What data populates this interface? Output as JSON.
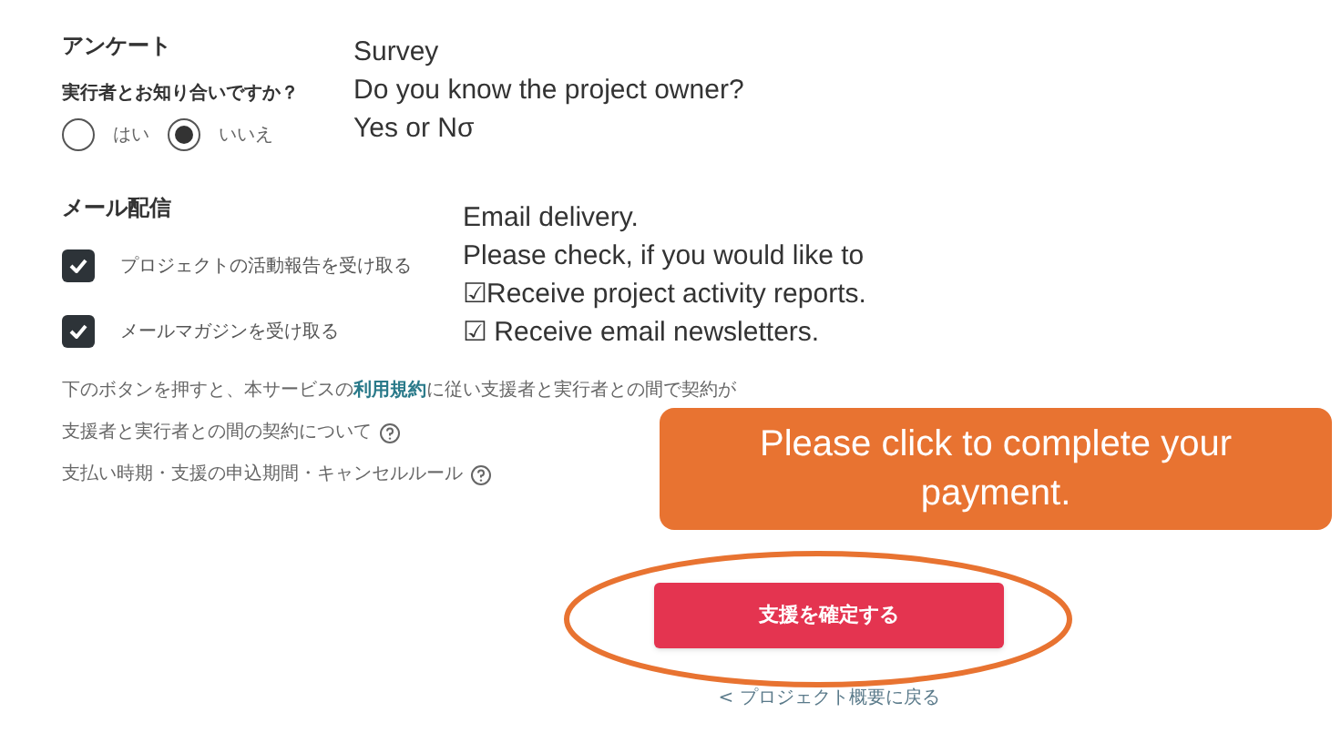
{
  "survey": {
    "heading": "アンケート",
    "question": "実行者とお知り合いですか？",
    "options": [
      {
        "label": "はい",
        "selected": false
      },
      {
        "label": "いいえ",
        "selected": true
      }
    ]
  },
  "email": {
    "heading": "メール配信",
    "options": [
      {
        "label": "プロジェクトの活動報告を受け取る",
        "checked": true
      },
      {
        "label": "メールマガジンを受け取る",
        "checked": true
      }
    ]
  },
  "terms": [
    {
      "kind": "text",
      "text": "下のボタンを押すと、本サービスの**利用規約**に従い支援者と実行者との間で契約が"
    },
    {
      "kind": "help",
      "text": "支援者と実行者との間の契約について"
    },
    {
      "kind": "help",
      "text": "支払い時期・支援の申込期間・キャンセルルール"
    }
  ],
  "confirm_button": "支援を確定する",
  "back_link": "< プロジェクト概要に戻る",
  "annotations": {
    "survey_note": [
      "Survey",
      "Do you know the project owner?",
      "Yes or Nσ"
    ],
    "email_note": [
      "Email delivery.",
      "Please check, if you would like to",
      "☑Receive project activity reports.",
      "☑ Receive email newsletters."
    ],
    "callout": "Please click to complete your payment."
  }
}
